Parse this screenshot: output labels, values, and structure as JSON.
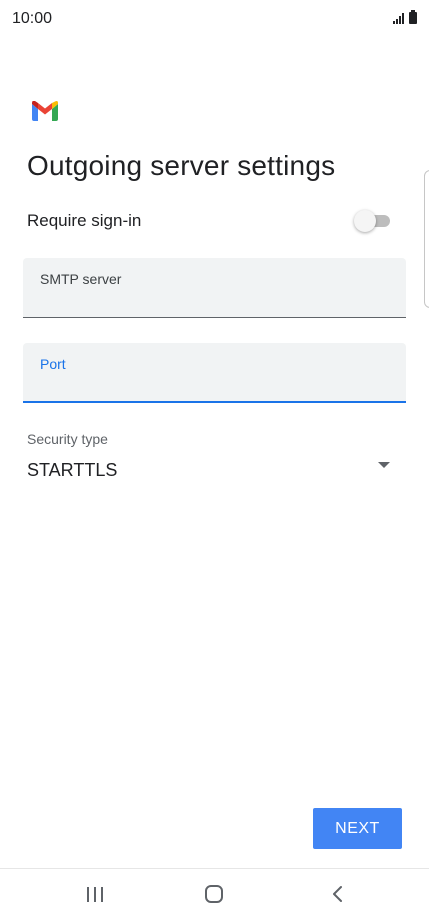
{
  "status_bar": {
    "time": "10:00",
    "icons": [
      "signal-icon",
      "battery-icon"
    ]
  },
  "app": {
    "logo": "gmail-logo"
  },
  "page": {
    "title": "Outgoing server settings"
  },
  "require_signin": {
    "label": "Require sign-in",
    "enabled": false
  },
  "smtp_server": {
    "label": "SMTP server",
    "value": ""
  },
  "port": {
    "label": "Port",
    "value": "",
    "focused": true
  },
  "security": {
    "label": "Security type",
    "selected": "STARTTLS"
  },
  "actions": {
    "next_label": "NEXT"
  },
  "navigation": {
    "buttons": [
      "recents-icon",
      "home-icon",
      "back-icon"
    ]
  },
  "colors": {
    "accent": "#1a73e8",
    "button": "#4285f4",
    "field_background": "#f1f3f4",
    "toggle_off": "#bdbdbd"
  }
}
